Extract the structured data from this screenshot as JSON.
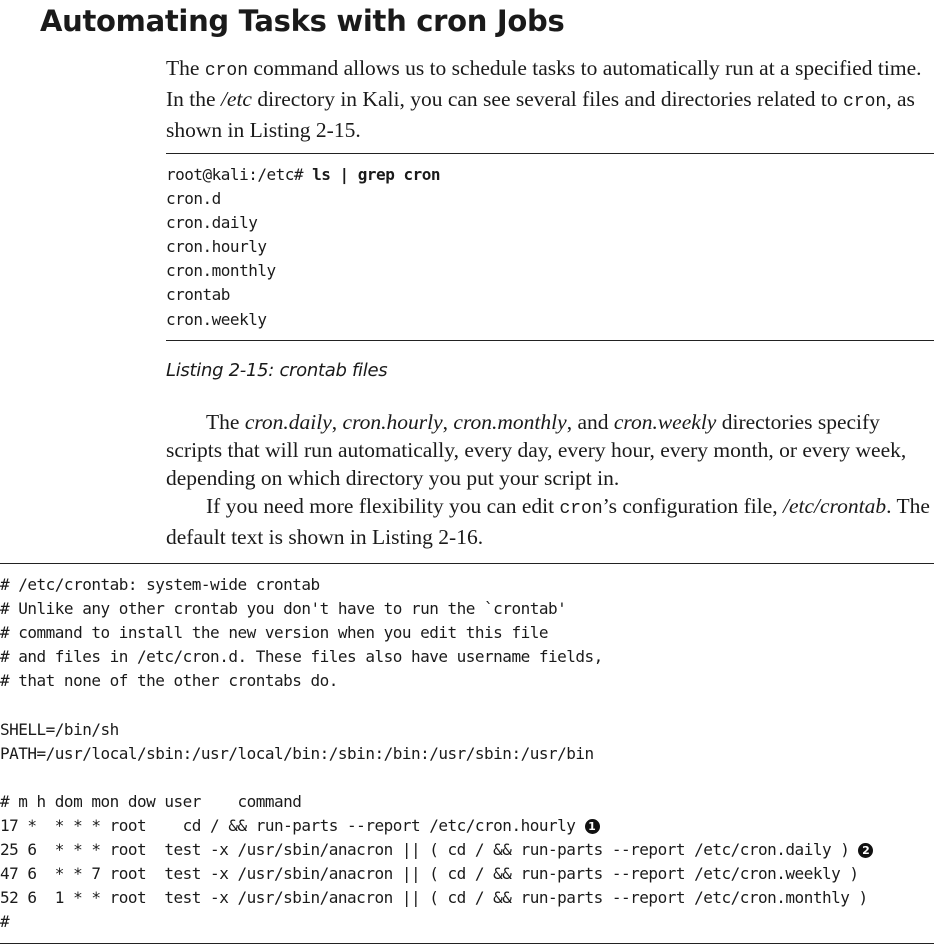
{
  "heading": "Automating Tasks with cron Jobs",
  "intro": {
    "part1": "The ",
    "cmd": "cron",
    "part2": " command allows us to schedule tasks to automatically run at a specified time. In the ",
    "path": "/etc",
    "part3": " directory in Kali, you can see several files and directories related to ",
    "cmd2": "cron",
    "part4": ", as shown in Listing 2-15."
  },
  "listing15": {
    "prompt": "root@kali:/etc# ",
    "command": "ls | grep cron",
    "output": [
      "cron.d",
      "cron.daily",
      "cron.hourly",
      "cron.monthly",
      "crontab",
      "cron.weekly"
    ],
    "caption": "Listing 2-15: crontab files"
  },
  "para2": {
    "part1": "The ",
    "dir1": "cron.daily",
    "sep1": ", ",
    "dir2": "cron.hourly",
    "sep2": ", ",
    "dir3": "cron.monthly",
    "sep3": ", and ",
    "dir4": "cron.weekly",
    "part2": " directories specify scripts that will run automatically, every day, every hour, every month, or every week, depending on which directory you put your script in."
  },
  "para3": {
    "part1": "If you need more flexibility you can edit ",
    "cmd": "cron",
    "part2": "’s configuration file, ",
    "path": "/etc/crontab",
    "part3": ". The default text is shown in Listing 2-16."
  },
  "listing16": {
    "comments": [
      "# /etc/crontab: system-wide crontab",
      "# Unlike any other crontab you don't have to run the `crontab'",
      "# command to install the new version when you edit this file",
      "# and files in /etc/cron.d. These files also have username fields,",
      "# that none of the other crontabs do."
    ],
    "shell": "SHELL=/bin/sh",
    "path": "PATH=/usr/local/sbin:/usr/local/bin:/sbin:/bin:/usr/sbin:/usr/bin",
    "header": "# m h dom mon dow user    command",
    "job1": "17 *  * * * root    cd / && run-parts --report /etc/cron.hourly ",
    "job2": "25 6  * * * root  test -x /usr/sbin/anacron || ( cd / && run-parts --report /etc/cron.daily ) ",
    "job3": "47 6  * * 7 root  test -x /usr/sbin/anacron || ( cd / && run-parts --report /etc/cron.weekly )",
    "job4": "52 6  1 * * root  test -x /usr/sbin/anacron || ( cd / && run-parts --report /etc/cron.monthly )",
    "end": "#",
    "callout1": "1",
    "callout2": "2"
  }
}
